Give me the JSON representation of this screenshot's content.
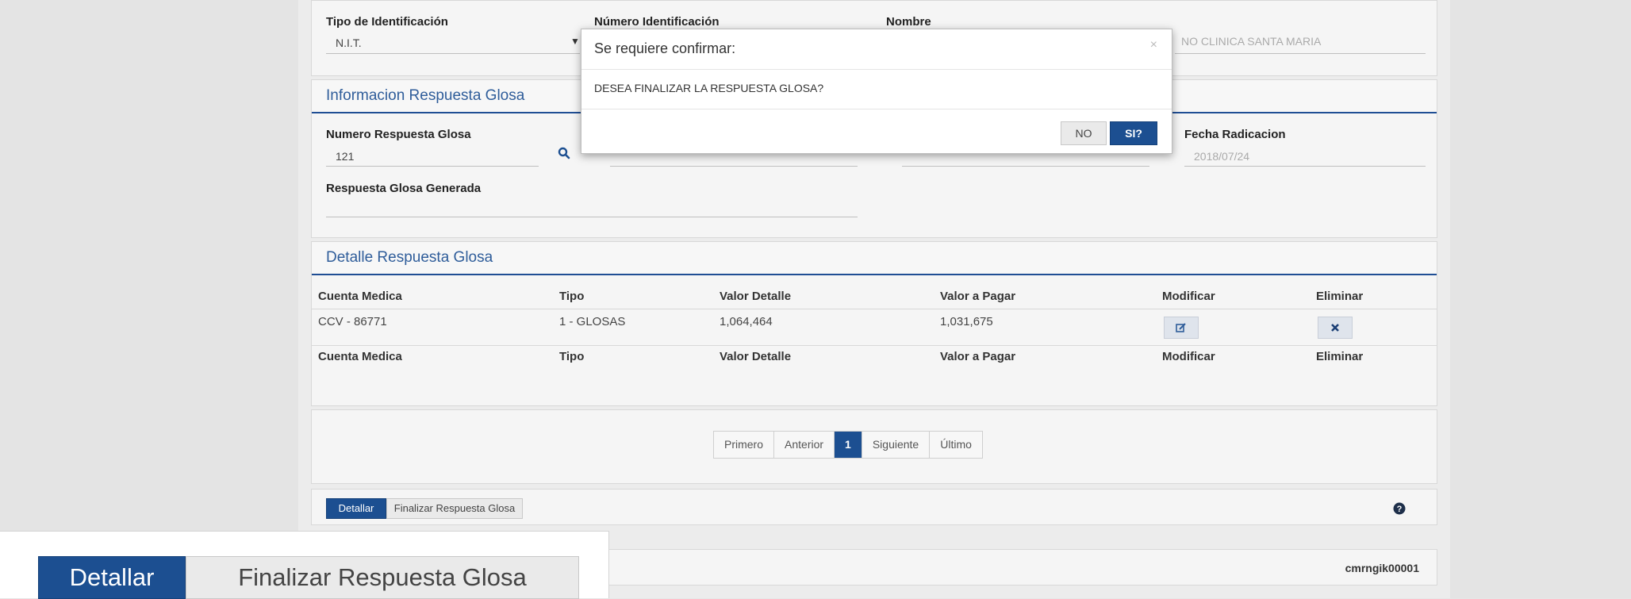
{
  "identification": {
    "tipo_label": "Tipo de Identificación",
    "tipo_value": "N.I.T.",
    "numero_label": "Número Identificación",
    "nombre_label": "Nombre",
    "nombre_value": "NO CLINICA SANTA MARIA"
  },
  "info_panel": {
    "title": "Informacion Respuesta Glosa",
    "numero_label": "Numero Respuesta Glosa",
    "numero_value": "121",
    "fecha_label": "Fecha Radicacion",
    "fecha_value": "2018/07/24",
    "generada_label": "Respuesta Glosa Generada"
  },
  "detalle_panel": {
    "title": "Detalle Respuesta Glosa",
    "columns": [
      "Cuenta Medica",
      "Tipo",
      "Valor Detalle",
      "Valor a Pagar",
      "Modificar",
      "Eliminar"
    ],
    "rows": [
      {
        "cuenta": "CCV - 86771",
        "tipo": "1 - GLOSAS",
        "valor_detalle": "1,064,464",
        "valor_pagar": "1,031,675"
      }
    ],
    "footer_columns": [
      "Cuenta Medica",
      "Tipo",
      "Valor Detalle",
      "Valor a Pagar",
      "Modificar",
      "Eliminar"
    ]
  },
  "pagination": {
    "first": "Primero",
    "prev": "Anterior",
    "current": "1",
    "next": "Siguiente",
    "last": "Último"
  },
  "actions": {
    "detallar": "Detallar",
    "finalizar": "Finalizar Respuesta Glosa"
  },
  "footer": {
    "user_code": "cmrngik00001"
  },
  "modal": {
    "title": "Se requiere confirmar:",
    "close": "×",
    "message": "DESEA FINALIZAR LA RESPUESTA GLOSA?",
    "no_label": "NO",
    "yes_label": "SI?"
  },
  "zoom_inset": {
    "detallar": "Detallar",
    "finalizar": "Finalizar Respuesta Glosa"
  },
  "colors": {
    "primary": "#1c4f91",
    "panel_title": "#2f5d9a"
  }
}
